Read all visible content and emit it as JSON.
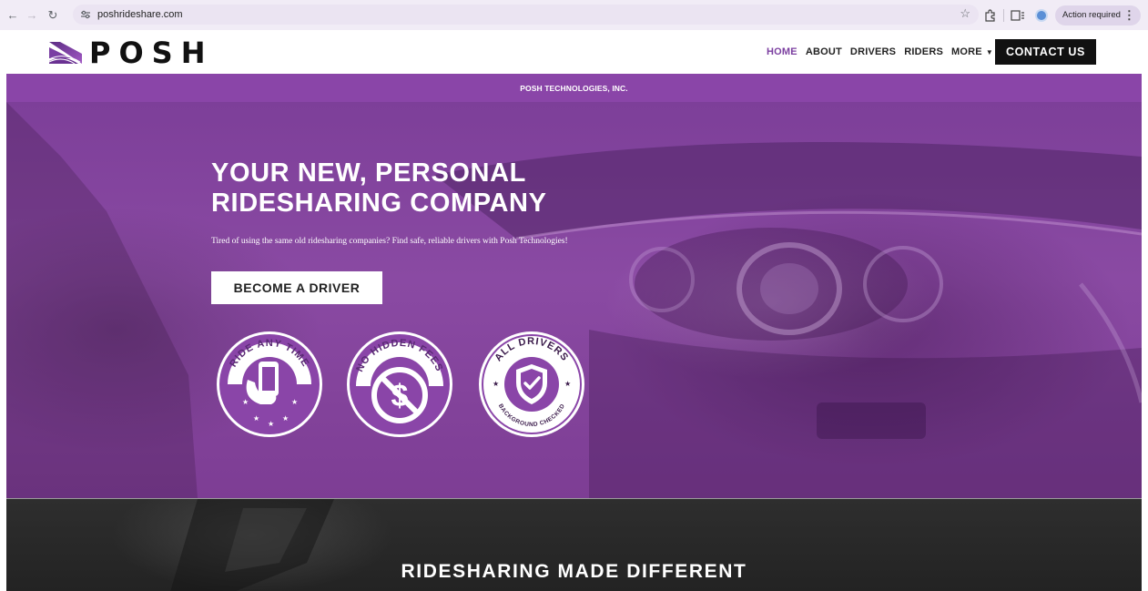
{
  "browser": {
    "url": "poshrideshare.com",
    "action_pill": "Action required",
    "icons": [
      "back-icon",
      "forward-icon",
      "reload-icon",
      "site-info-icon",
      "bookmark-star-icon",
      "extensions-icon",
      "reading-mode-icon",
      "profile-avatar",
      "menu-kebab-icon"
    ]
  },
  "header": {
    "logo_text": "POSH",
    "nav": [
      {
        "label": "HOME",
        "active": true
      },
      {
        "label": "ABOUT",
        "active": false
      },
      {
        "label": "DRIVERS",
        "active": false
      },
      {
        "label": "RIDERS",
        "active": false
      },
      {
        "label": "MORE",
        "active": false
      }
    ],
    "contact_label": "CONTACT US"
  },
  "banner": {
    "text": "POSH TECHNOLOGIES, INC."
  },
  "hero": {
    "title_line1": "YOUR NEW, PERSONAL",
    "title_line2": "RIDESHARING COMPANY",
    "subtitle": "Tired of using the same old ridesharing companies? Find safe, reliable drivers with Posh Technologies!",
    "cta_label": "BECOME A DRIVER",
    "badges": [
      {
        "top_text": "RIDE ANY TIME",
        "bottom_text": ""
      },
      {
        "top_text": "NO HIDDEN FEES",
        "bottom_text": ""
      },
      {
        "top_text": "ALL DRIVERS",
        "bottom_text": "BACKGROUND CHECKED"
      }
    ]
  },
  "section": {
    "title": "RIDESHARING MADE DIFFERENT"
  },
  "colors": {
    "brand_purple": "#8a45a8",
    "hero_purple": "#7d3f99",
    "active_nav": "#7b3fa0",
    "dark_section": "#2a2a2a"
  }
}
